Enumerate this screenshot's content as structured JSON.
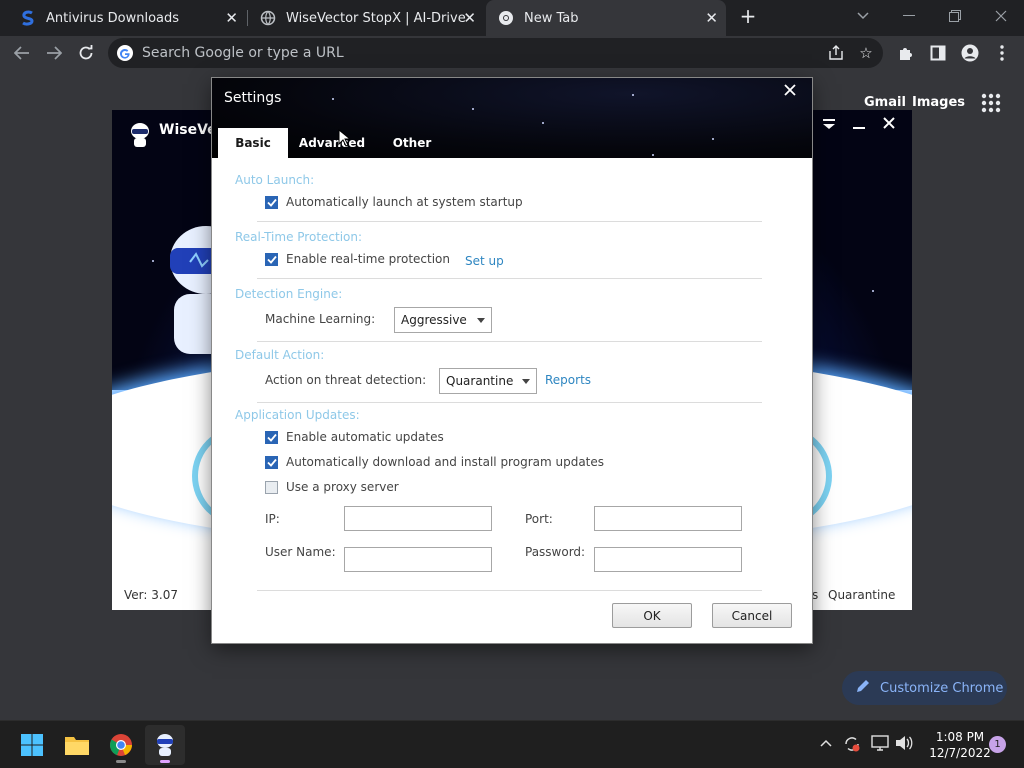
{
  "browser": {
    "tabs": [
      {
        "title": "Antivirus Downloads",
        "favicon": "softpedia-s-icon",
        "active": false
      },
      {
        "title": "WiseVector StopX | AI-Driven Ma",
        "favicon": "globe-icon",
        "active": false
      },
      {
        "title": "New Tab",
        "favicon": "chrome-icon",
        "active": true
      }
    ],
    "omnibox_placeholder": "Search Google or type a URL",
    "ntp": {
      "gmail": "Gmail",
      "images": "Images",
      "customize": "Customize Chrome"
    }
  },
  "wisevector": {
    "title": "WiseVec",
    "version": "Ver: 3.07",
    "quarantine": "Quarantine",
    "s_fragment": "s"
  },
  "settings": {
    "title": "Settings",
    "tabs": [
      "Basic",
      "Advanced",
      "Other"
    ],
    "active_tab": "Basic",
    "auto_launch": {
      "heading": "Auto Launch:",
      "option": "Automatically launch at system startup",
      "checked": true
    },
    "realtime": {
      "heading": "Real-Time Protection:",
      "option": "Enable real-time protection",
      "checked": true,
      "setup_link": "Set up"
    },
    "engine": {
      "heading": "Detection Engine:",
      "label": "Machine Learning:",
      "value": "Aggressive"
    },
    "default_action": {
      "heading": "Default Action:",
      "label": "Action on threat detection:",
      "value": "Quarantine",
      "reports_link": "Reports"
    },
    "updates": {
      "heading": "Application Updates:",
      "auto_updates": {
        "label": "Enable automatic updates",
        "checked": true
      },
      "auto_install": {
        "label": "Automatically download and install program updates",
        "checked": true
      },
      "proxy": {
        "label": "Use a proxy server",
        "checked": false
      },
      "ip_label": "IP:",
      "port_label": "Port:",
      "user_label": "User Name:",
      "password_label": "Password:",
      "ip_value": "",
      "port_value": "",
      "user_value": "",
      "password_value": ""
    },
    "ok": "OK",
    "cancel": "Cancel"
  },
  "taskbar": {
    "time": "1:08 PM",
    "date": "12/7/2022",
    "notifications": "1"
  },
  "colors": {
    "section_heading": "#8ec8e8",
    "link": "#2e86c1",
    "checkbox_on": "#2a65b5",
    "chrome_dark": "#202124",
    "chrome_toolbar": "#35363a",
    "customize_text": "#8ab4f8"
  }
}
